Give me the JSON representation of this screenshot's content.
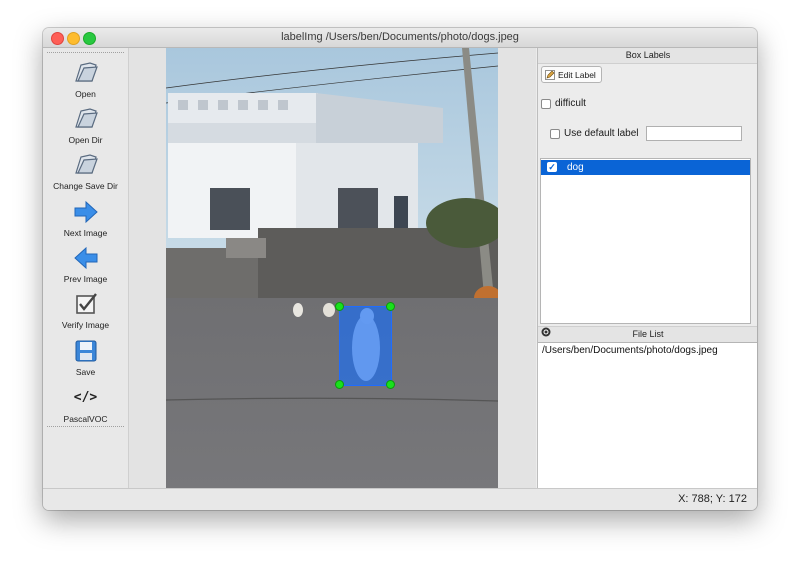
{
  "window": {
    "title": "labelImg /Users/ben/Documents/photo/dogs.jpeg"
  },
  "toolbar": {
    "items": [
      {
        "label": "Open",
        "icon": "folder-icon"
      },
      {
        "label": "Open Dir",
        "icon": "folder-icon"
      },
      {
        "label": "Change Save Dir",
        "icon": "folder-icon"
      },
      {
        "label": "Next Image",
        "icon": "arrow-right-icon"
      },
      {
        "label": "Prev Image",
        "icon": "arrow-left-icon"
      },
      {
        "label": "Verify Image",
        "icon": "checkbox-icon"
      },
      {
        "label": "Save",
        "icon": "floppy-icon"
      },
      {
        "label": "PascalVOC",
        "icon": "code-icon"
      }
    ],
    "code_glyph": "</>",
    "expand_glyph": "»"
  },
  "box_labels": {
    "title": "Box Labels",
    "edit_label": "Edit Label",
    "difficult": "difficult",
    "use_default_label": "Use default label",
    "default_label_value": "",
    "labels": [
      {
        "name": "dog",
        "checked": true
      }
    ]
  },
  "file_list": {
    "title": "File List",
    "files": [
      "/Users/ben/Documents/photo/dogs.jpeg"
    ]
  },
  "status": {
    "coords": "X: 788; Y: 172"
  },
  "colors": {
    "selection": "#0a64d6",
    "bbox_fill": "#146eff",
    "handle": "#19e01c",
    "arrow_blue": "#3a8ee8"
  }
}
